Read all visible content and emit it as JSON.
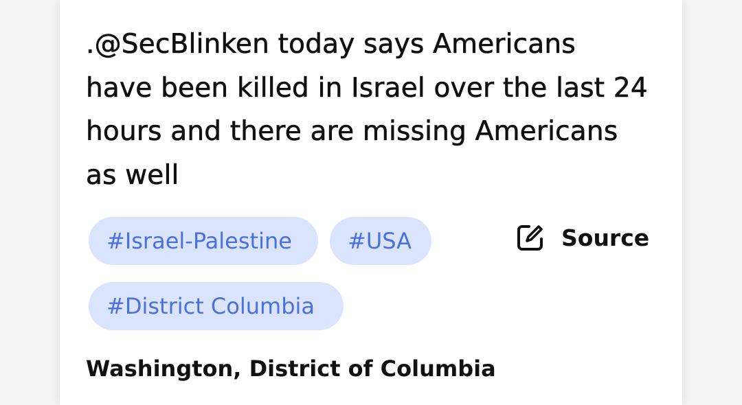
{
  "article": {
    "headline": ".@SecBlinken today says Americans have been killed in Israel over the last 24 hours and there are missing Americans as well",
    "tags": [
      "#Israel-Palestine",
      "#USA",
      "#District Columbia"
    ],
    "source_label": "Source",
    "source_icon": "edit-square-icon",
    "location": "Washington, District of Columbia"
  },
  "colors": {
    "tag_background": "#dbe4fd",
    "tag_text": "#4a70e0",
    "text": "#111111",
    "card": "#ffffff"
  }
}
